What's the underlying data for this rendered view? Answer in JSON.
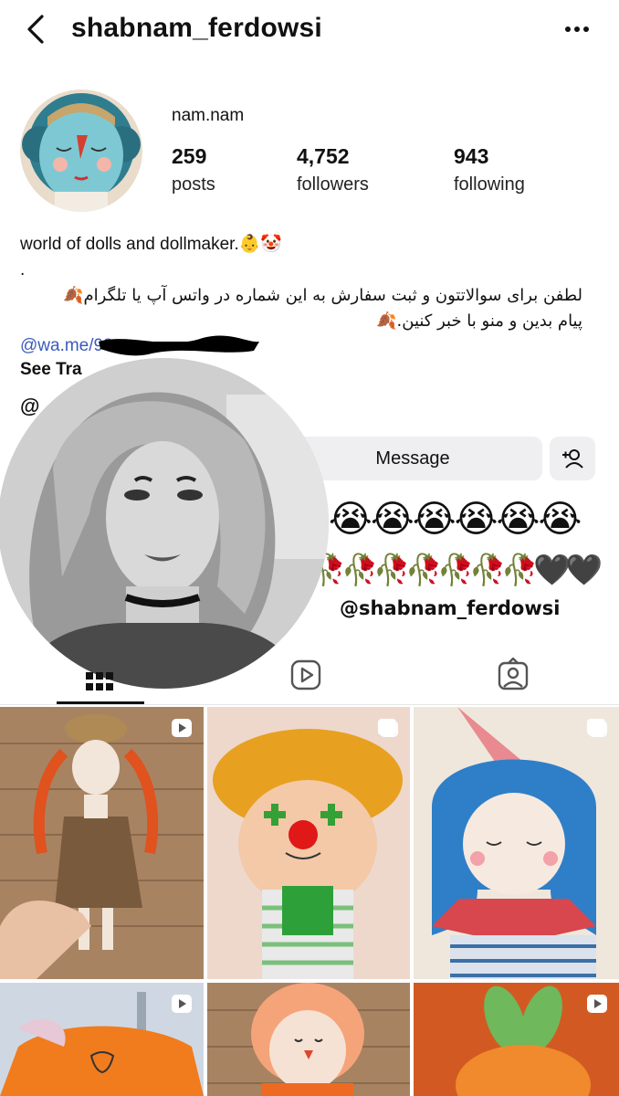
{
  "header": {
    "username": "shabnam_ferdowsi"
  },
  "profile": {
    "display_name": "nam.nam",
    "stats": [
      {
        "value": "259",
        "label": "posts"
      },
      {
        "value": "4,752",
        "label": "followers"
      },
      {
        "value": "943",
        "label": "following"
      }
    ],
    "bio_line1": "world of dolls and dollmaker.👶🤡",
    "bio_dot": ".",
    "bio_fa_line1": "لطفن برای سوالاتتون و ثبت سفارش به این شماره در واتس آپ یا تلگرام🍂",
    "bio_fa_line2": "پیام بدین و منو با خبر کنین.🍂",
    "link_text": "@wa.me/98",
    "see_translation": "See Tra",
    "threads_symbol": "@"
  },
  "actions": {
    "message_label": "Message"
  },
  "sticker": {
    "emoji_row": "😭😭😭😭😭😭😭",
    "roses_row": "🥀🥀🥀🥀🥀🥀🥀🥀🥀🥀🥀🖤🖤",
    "handle": "@shabnam_ferdowsi"
  },
  "tabs": [
    {
      "name": "grid",
      "icon": "grid-icon",
      "active": true
    },
    {
      "name": "reels",
      "icon": "reels-icon",
      "active": false
    },
    {
      "name": "tagged",
      "icon": "tagged-icon",
      "active": false
    }
  ],
  "colors": {
    "link": "#3b5bbd",
    "button_bg": "#efeff2"
  }
}
